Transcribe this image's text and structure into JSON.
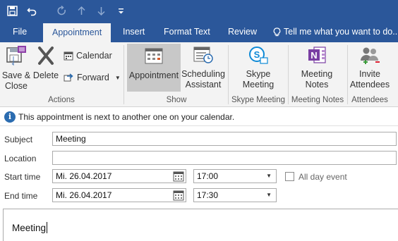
{
  "quick_access": {
    "icons": [
      "save-icon",
      "undo-icon",
      "redo-icon",
      "up-icon",
      "down-icon",
      "customize-icon"
    ]
  },
  "tabs": [
    {
      "label": "File"
    },
    {
      "label": "Appointment"
    },
    {
      "label": "Insert"
    },
    {
      "label": "Format Text"
    },
    {
      "label": "Review"
    },
    {
      "label": "Tell me what you want to do..."
    }
  ],
  "ribbon": {
    "actions": {
      "save_close_line1": "Save &",
      "save_close_line2": "Close",
      "delete": "Delete",
      "calendar": "Calendar",
      "forward": "Forward",
      "group": "Actions"
    },
    "show": {
      "appointment": "Appointment",
      "scheduling_line1": "Scheduling",
      "scheduling_line2": "Assistant",
      "group": "Show"
    },
    "skype": {
      "line1": "Skype",
      "line2": "Meeting",
      "group": "Skype Meeting"
    },
    "notes": {
      "line1": "Meeting",
      "line2": "Notes",
      "group": "Meeting Notes"
    },
    "attendees": {
      "line1": "Invite",
      "line2": "Attendees",
      "group": "Attendees"
    }
  },
  "info_bar": {
    "message": "This appointment is next to another one on your calendar."
  },
  "form": {
    "subject_label": "Subject",
    "subject_value": "Meeting",
    "location_label": "Location",
    "location_value": "",
    "start_label": "Start time",
    "start_date": "Mi. 26.04.2017",
    "start_time": "17:00",
    "end_label": "End time",
    "end_date": "Mi. 26.04.2017",
    "end_time": "17:30",
    "all_day_label": "All day event",
    "all_day_checked": false
  },
  "body": {
    "text": "Meeting"
  },
  "colors": {
    "accent": "#2b579a",
    "ribbon_bg": "#f3f3f3",
    "selected": "#c8c8c8"
  }
}
